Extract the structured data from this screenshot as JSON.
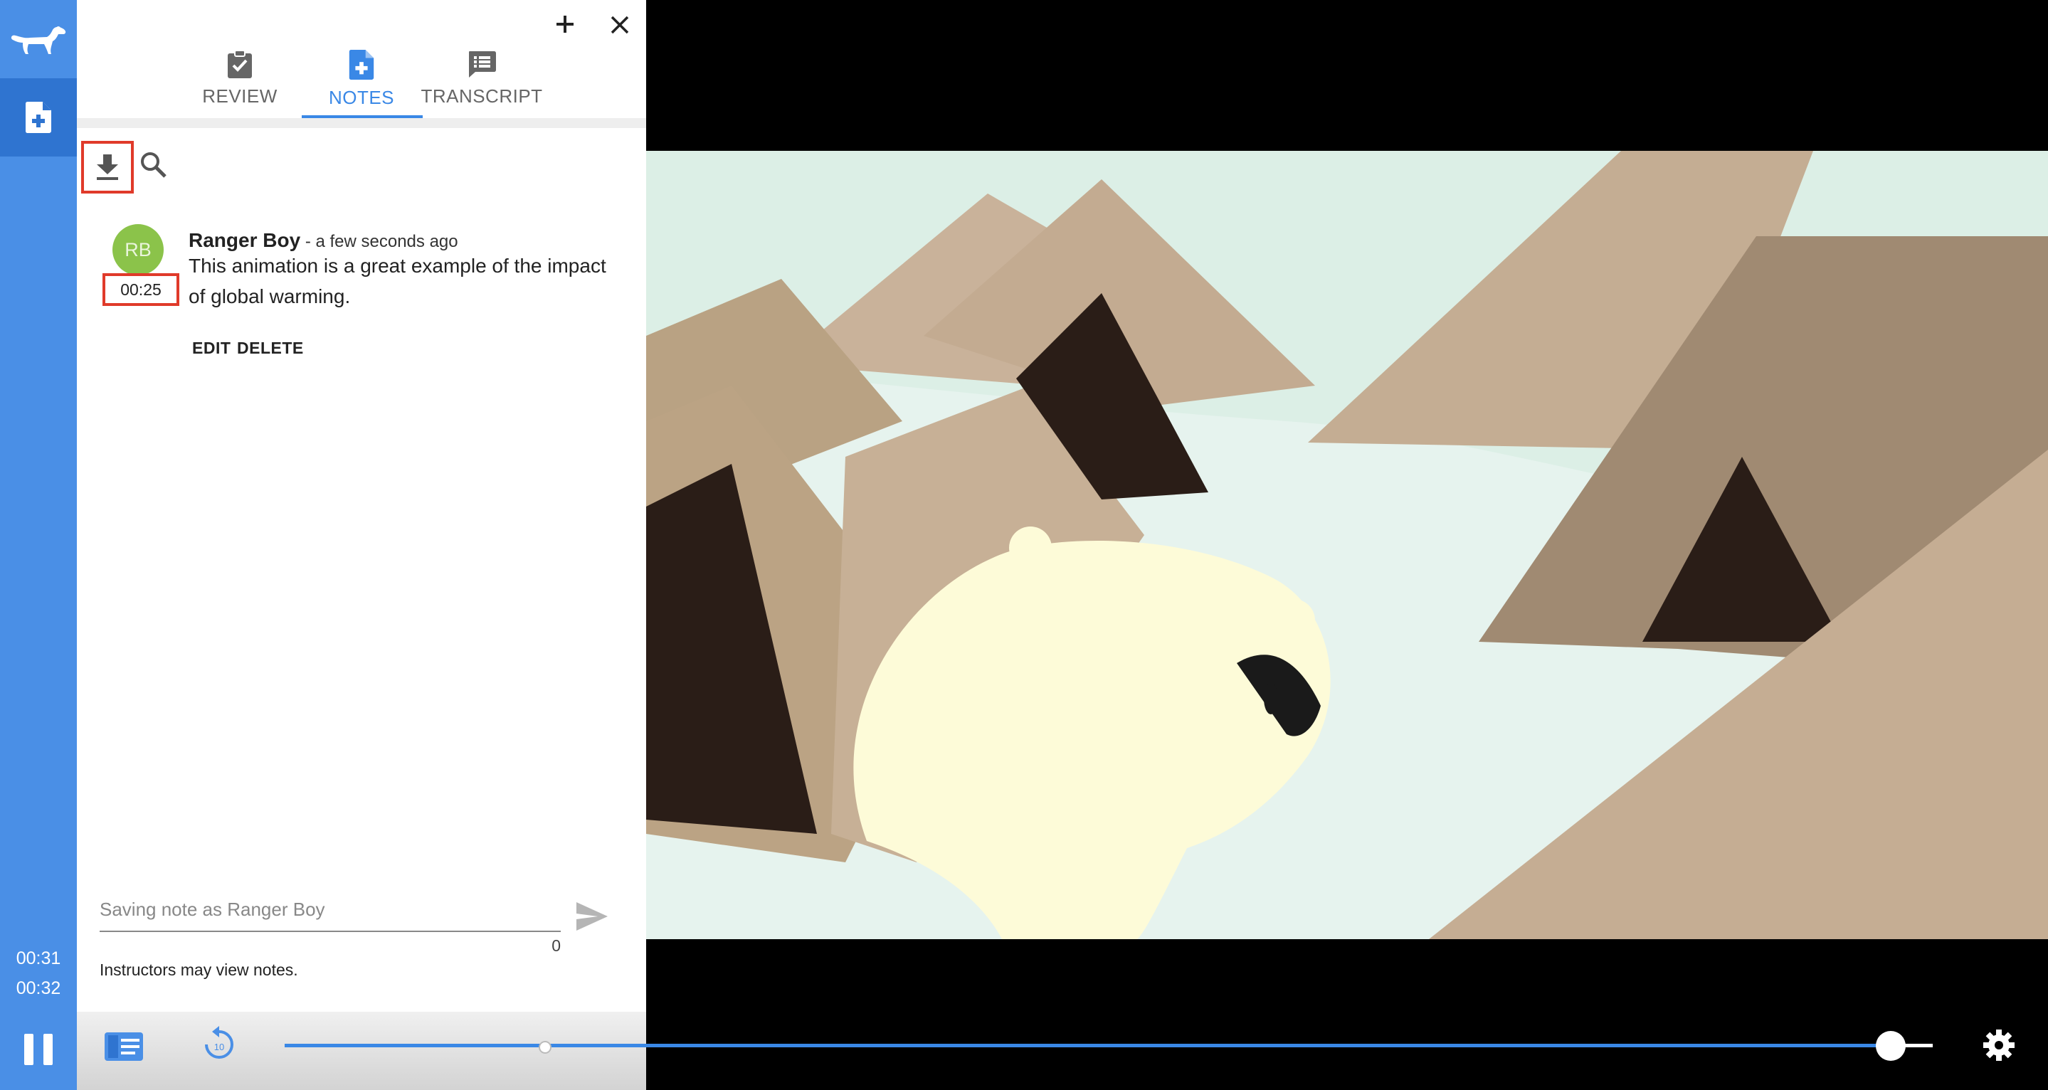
{
  "rail": {
    "elapsed": "00:31",
    "duration": "00:32"
  },
  "tabs": [
    {
      "label": "REVIEW",
      "icon": "clipboard-check-icon"
    },
    {
      "label": "NOTES",
      "icon": "note-add-icon"
    },
    {
      "label": "TRANSCRIPT",
      "icon": "transcript-icon"
    }
  ],
  "active_tab": "NOTES",
  "note": {
    "avatar_initials": "RB",
    "timestamp": "00:25",
    "author": "Ranger Boy",
    "when": " - a few seconds ago",
    "text": "This animation is a great example of the impact of global warming.",
    "edit_label": "EDIT",
    "delete_label": "DELETE"
  },
  "composer": {
    "placeholder": "Saving note as Ranger Boy",
    "char_count": "0",
    "privacy_text": "Instructors may view notes."
  },
  "colors": {
    "accent": "#3a88e6",
    "rail": "#4a8fe6",
    "avatar": "#8bc34a",
    "highlight": "#e03a2a"
  },
  "seek": {
    "progress": 0.97
  }
}
